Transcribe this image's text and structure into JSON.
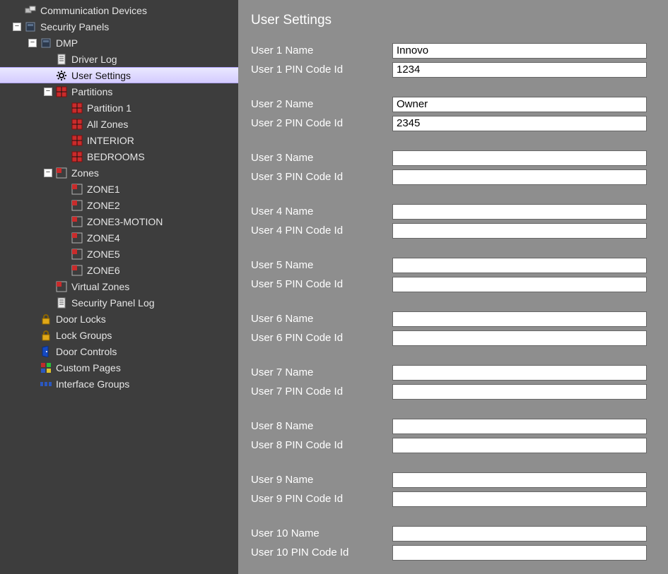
{
  "sidebar": {
    "items": [
      {
        "indent": 0,
        "toggle": "none",
        "icon": "devices-icon",
        "label": "Communication Devices",
        "selected": false
      },
      {
        "indent": 0,
        "toggle": "minus",
        "icon": "panel-icon",
        "label": "Security Panels",
        "selected": false
      },
      {
        "indent": 1,
        "toggle": "minus",
        "icon": "panel-icon",
        "label": "DMP",
        "selected": false
      },
      {
        "indent": 2,
        "toggle": "none",
        "icon": "log-icon",
        "label": "Driver Log",
        "selected": false
      },
      {
        "indent": 2,
        "toggle": "none",
        "icon": "gear-icon",
        "label": "User Settings",
        "selected": true
      },
      {
        "indent": 2,
        "toggle": "minus",
        "icon": "partition-icon",
        "label": "Partitions",
        "selected": false
      },
      {
        "indent": 3,
        "toggle": "none",
        "icon": "partition-icon",
        "label": "Partition 1",
        "selected": false
      },
      {
        "indent": 3,
        "toggle": "none",
        "icon": "partition-icon",
        "label": "All Zones",
        "selected": false
      },
      {
        "indent": 3,
        "toggle": "none",
        "icon": "partition-icon",
        "label": "INTERIOR",
        "selected": false
      },
      {
        "indent": 3,
        "toggle": "none",
        "icon": "partition-icon",
        "label": "BEDROOMS",
        "selected": false
      },
      {
        "indent": 2,
        "toggle": "minus",
        "icon": "zone-icon",
        "label": "Zones",
        "selected": false
      },
      {
        "indent": 3,
        "toggle": "none",
        "icon": "zone-icon",
        "label": "ZONE1",
        "selected": false
      },
      {
        "indent": 3,
        "toggle": "none",
        "icon": "zone-icon",
        "label": "ZONE2",
        "selected": false
      },
      {
        "indent": 3,
        "toggle": "none",
        "icon": "zone-icon",
        "label": "ZONE3-MOTION",
        "selected": false
      },
      {
        "indent": 3,
        "toggle": "none",
        "icon": "zone-icon",
        "label": "ZONE4",
        "selected": false
      },
      {
        "indent": 3,
        "toggle": "none",
        "icon": "zone-icon",
        "label": "ZONE5",
        "selected": false
      },
      {
        "indent": 3,
        "toggle": "none",
        "icon": "zone-icon",
        "label": "ZONE6",
        "selected": false
      },
      {
        "indent": 2,
        "toggle": "none",
        "icon": "zone-icon",
        "label": "Virtual Zones",
        "selected": false
      },
      {
        "indent": 2,
        "toggle": "none",
        "icon": "log-icon",
        "label": "Security Panel Log",
        "selected": false
      },
      {
        "indent": 1,
        "toggle": "none",
        "icon": "lock-icon",
        "label": "Door Locks",
        "selected": false
      },
      {
        "indent": 1,
        "toggle": "none",
        "icon": "lock-icon",
        "label": "Lock Groups",
        "selected": false
      },
      {
        "indent": 1,
        "toggle": "none",
        "icon": "door-icon",
        "label": "Door Controls",
        "selected": false
      },
      {
        "indent": 1,
        "toggle": "none",
        "icon": "custom-icon",
        "label": "Custom Pages",
        "selected": false
      },
      {
        "indent": 1,
        "toggle": "none",
        "icon": "interface-icon",
        "label": "Interface Groups",
        "selected": false
      }
    ]
  },
  "panel": {
    "title": "User Settings",
    "users": [
      {
        "name_label": "User 1 Name",
        "name_value": "Innovo",
        "pin_label": "User 1 PIN Code Id",
        "pin_value": "1234"
      },
      {
        "name_label": "User 2 Name",
        "name_value": "Owner",
        "pin_label": "User 2 PIN Code Id",
        "pin_value": "2345"
      },
      {
        "name_label": "User 3 Name",
        "name_value": "",
        "pin_label": "User 3 PIN Code Id",
        "pin_value": ""
      },
      {
        "name_label": "User 4 Name",
        "name_value": "",
        "pin_label": "User 4 PIN Code Id",
        "pin_value": ""
      },
      {
        "name_label": "User 5 Name",
        "name_value": "",
        "pin_label": "User 5 PIN Code Id",
        "pin_value": ""
      },
      {
        "name_label": "User 6 Name",
        "name_value": "",
        "pin_label": "User 6 PIN Code Id",
        "pin_value": ""
      },
      {
        "name_label": "User 7 Name",
        "name_value": "",
        "pin_label": "User 7 PIN Code Id",
        "pin_value": ""
      },
      {
        "name_label": "User 8 Name",
        "name_value": "",
        "pin_label": "User 8 PIN Code Id",
        "pin_value": ""
      },
      {
        "name_label": "User 9 Name",
        "name_value": "",
        "pin_label": "User 9 PIN Code Id",
        "pin_value": ""
      },
      {
        "name_label": "User 10 Name",
        "name_value": "",
        "pin_label": "User 10 PIN Code Id",
        "pin_value": ""
      }
    ]
  }
}
